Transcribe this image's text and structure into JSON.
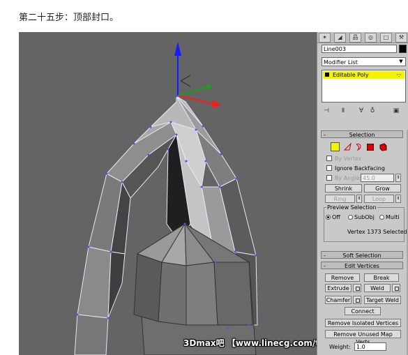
{
  "caption": "第二十五步：顶部封口。",
  "watermark": "3Dmax吧 【www.linecg.com/tieba/1771】",
  "command_panel": {
    "tabs": [
      "create-tab",
      "modify-tab",
      "hierarchy-tab",
      "motion-tab",
      "display-tab",
      "utilities-tab"
    ],
    "object_name": "Line003",
    "object_color": "#000000",
    "modifier_list_label": "Modifier List",
    "stack_item": "Editable Poly",
    "stack_highlight_color": "#f4f400"
  },
  "selection": {
    "title": "Selection",
    "subobject_icons": [
      "vertex-icon",
      "edge-icon",
      "border-icon",
      "polygon-icon",
      "element-icon"
    ],
    "by_vertex": "By Vertex",
    "ignore_backfacing": "Ignore Backfacing",
    "by_angle": "By Angle:",
    "angle_value": "45.0",
    "shrink": "Shrink",
    "grow": "Grow",
    "ring": "Ring",
    "loop": "Loop",
    "preview_selection": "Preview Selection",
    "preview_off": "Off",
    "preview_subobj": "SubObj",
    "preview_multi": "Multi",
    "status": "Vertex 1373 Selected"
  },
  "soft_selection": {
    "title": "Soft Selection"
  },
  "edit_vertices": {
    "title": "Edit Vertices",
    "remove": "Remove",
    "break": "Break",
    "extrude": "Extrude",
    "weld": "Weld",
    "chamfer": "Chamfer",
    "target_weld": "Target Weld",
    "connect": "Connect",
    "remove_isolated": "Remove Isolated Vertices",
    "remove_unused": "Remove Unused Map Verts",
    "weight_label": "Weight:",
    "weight_value": "1.0"
  },
  "minus": "-",
  "gizmo": {
    "x": "X",
    "y": "Y",
    "z": "Z"
  }
}
